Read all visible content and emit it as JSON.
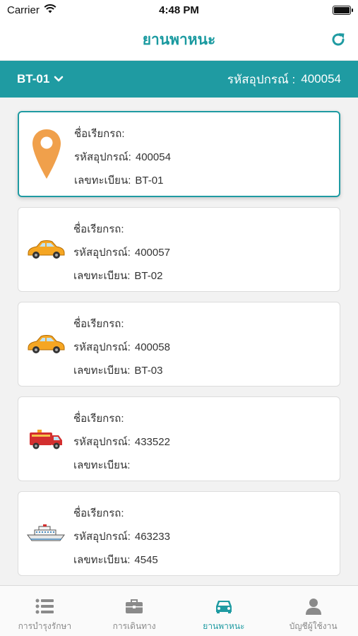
{
  "status_bar": {
    "carrier": "Carrier",
    "time": "4:48 PM"
  },
  "nav": {
    "title": "ยานพาหนะ"
  },
  "device_bar": {
    "selected": "BT-01",
    "code_label": "รหัสอุปกรณ์ :",
    "code_value": "400054"
  },
  "labels": {
    "name": "ชื่อเรียกรถ:",
    "device": "รหัสอุปกรณ์:",
    "plate": "เลขทะเบียน:"
  },
  "vehicles": [
    {
      "icon": "location-pin-icon",
      "name": "",
      "device": "400054",
      "plate": "BT-01",
      "active": true
    },
    {
      "icon": "car-icon",
      "name": "",
      "device": "400057",
      "plate": "BT-02"
    },
    {
      "icon": "car-icon",
      "name": "",
      "device": "400058",
      "plate": "BT-03"
    },
    {
      "icon": "truck-icon",
      "name": "",
      "device": "433522",
      "plate": ""
    },
    {
      "icon": "ship-icon",
      "name": "",
      "device": "463233",
      "plate": "4545"
    }
  ],
  "tabs": [
    {
      "label": "การบำรุงรักษา",
      "icon": "list-icon"
    },
    {
      "label": "การเดินทาง",
      "icon": "briefcase-icon"
    },
    {
      "label": "ยานพาหนะ",
      "icon": "car-icon",
      "active": true
    },
    {
      "label": "บัญชีผู้ใช้งาน",
      "icon": "user-icon"
    }
  ],
  "colors": {
    "accent": "#1f9ba2",
    "pin": "#f0a04b",
    "car": "#f5a623",
    "truck": "#d32f2f"
  }
}
